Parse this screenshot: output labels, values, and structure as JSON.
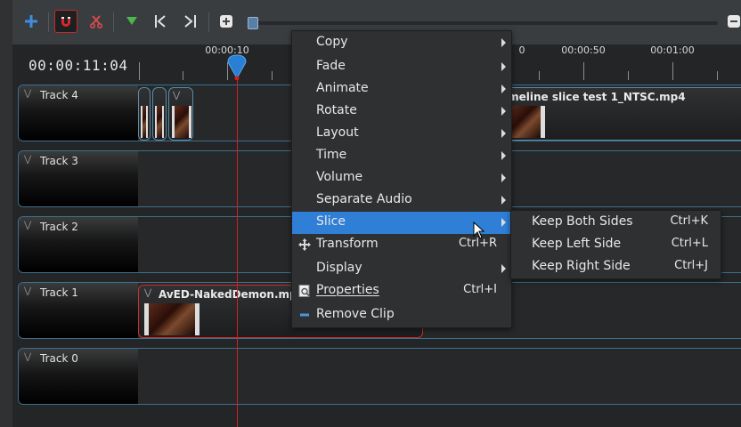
{
  "toolbar": {
    "buttons": [
      {
        "name": "add-track-button",
        "icon": "plus-icon"
      },
      {
        "name": "snap-toggle-button",
        "icon": "magnet-icon"
      },
      {
        "name": "razor-button",
        "icon": "scissors-icon"
      },
      {
        "name": "add-marker-button",
        "icon": "marker-icon"
      },
      {
        "name": "previous-marker-button",
        "icon": "jump-previous-icon"
      },
      {
        "name": "next-marker-button",
        "icon": "jump-next-icon"
      },
      {
        "name": "center-playhead-button",
        "icon": "center-icon"
      }
    ],
    "zoom_level": 0.01
  },
  "timeline": {
    "timecode": "00:00:11:04",
    "ruler_labels": [
      "00:00:10",
      "00:00:50",
      "00:01:00"
    ],
    "ruler_partial_label": "0"
  },
  "tracks": [
    {
      "name": "Track 4"
    },
    {
      "name": "Track 3"
    },
    {
      "name": "Track 2"
    },
    {
      "name": "Track 1"
    },
    {
      "name": "Track 0"
    }
  ],
  "clips": {
    "track4_right": {
      "title": "imeline slice test 1_NTSC.mp4"
    },
    "track1_main": {
      "title": "AvED-NakedDemon.mp4"
    }
  },
  "context_menu": {
    "items": [
      {
        "label": "Copy",
        "submenu": true
      },
      {
        "label": "Fade",
        "submenu": true
      },
      {
        "label": "Animate",
        "submenu": true
      },
      {
        "label": "Rotate",
        "submenu": true
      },
      {
        "label": "Layout",
        "submenu": true
      },
      {
        "label": "Time",
        "submenu": true
      },
      {
        "label": "Volume",
        "submenu": true
      },
      {
        "label": "Separate Audio",
        "submenu": true
      },
      {
        "label": "Slice",
        "submenu": true,
        "highlighted": true
      },
      {
        "label": "Transform",
        "shortcut": "Ctrl+R",
        "icon": "move-icon"
      },
      {
        "label": "Display",
        "submenu": true
      },
      {
        "label": "Properties",
        "shortcut": "Ctrl+I",
        "icon": "properties-icon"
      },
      {
        "label": "Remove Clip",
        "icon": "minus-icon"
      }
    ]
  },
  "slice_submenu": {
    "items": [
      {
        "label": "Keep Both Sides",
        "shortcut": "Ctrl+K"
      },
      {
        "label": "Keep Left Side",
        "shortcut": "Ctrl+L"
      },
      {
        "label": "Keep Right Side",
        "shortcut": "Ctrl+J"
      }
    ]
  },
  "colors": {
    "highlight": "#2f7fd7",
    "selected_clip_border": "#d12b2b",
    "playhead": "#d22020",
    "track_border": "#3e6f8f"
  }
}
